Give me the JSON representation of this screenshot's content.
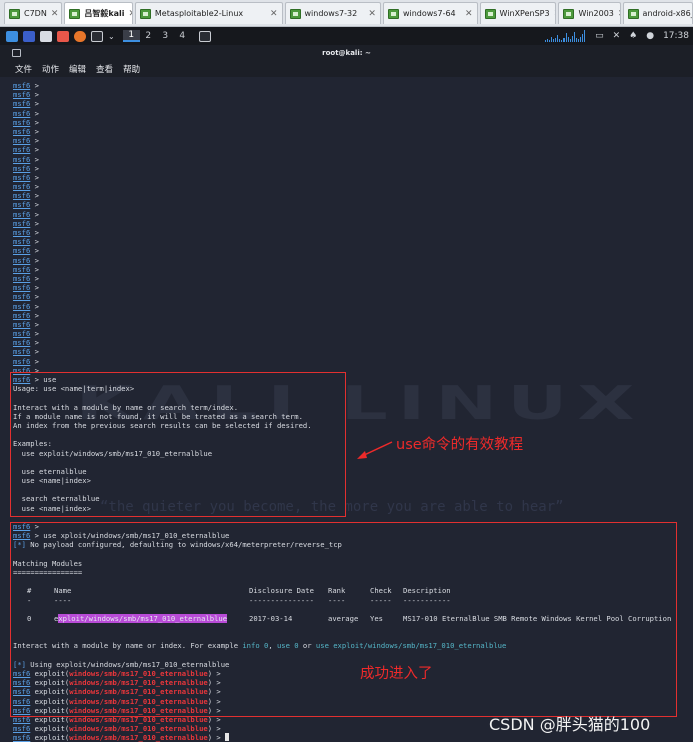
{
  "vm_tabs": [
    {
      "label": "C7DN",
      "active": false
    },
    {
      "label": "吕智毅kali",
      "active": true
    },
    {
      "label": "Metasploitable2-Linux",
      "active": false
    },
    {
      "label": "windows7-32",
      "active": false
    },
    {
      "label": "windows7-64",
      "active": false
    },
    {
      "label": "WinXPenSP3",
      "active": false
    },
    {
      "label": "Win2003",
      "active": false
    },
    {
      "label": "android-x86_64-7...",
      "active": false
    }
  ],
  "panel": {
    "workspaces": [
      "1",
      "2",
      "3",
      "4"
    ],
    "clock": "17:38"
  },
  "window_title": "root@kali: ~",
  "menu": [
    "文件",
    "动作",
    "编辑",
    "查看",
    "帮助"
  ],
  "prompt": "msf6",
  "empty_prompt_count": 32,
  "use_help": [
    "Usage: use <name|term|index>",
    "",
    "Interact with a module by name or search term/index.",
    "If a module name is not found, it will be treated as a search term.",
    "An index from the previous search results can be selected if desired.",
    "",
    "Examples:",
    "  use exploit/windows/smb/ms17_010_eternalblue",
    "",
    "  use eternalblue",
    "  use <name|index>",
    "",
    "  search eternalblue",
    "  use <name|index>"
  ],
  "cmd_use": " > use",
  "cmd_use_exploit": " > use xploit/windows/smb/ms17_010_eternalblue",
  "payload_tag": "[*]",
  "payload_msg": " No payload configured, defaulting to windows/x64/meterpreter/reverse_tcp",
  "matching_title": "Matching Modules",
  "matching_underline": "================",
  "table": {
    "headers": [
      "#",
      "Name",
      "Disclosure Date",
      "Rank",
      "Check",
      "Description"
    ],
    "underlines": [
      "-",
      "----",
      "---------------",
      "----",
      "-----",
      "-----------"
    ],
    "row": {
      "index": "0",
      "name_first": "e",
      "name_rest": "xploit/windows/smb/ms17_010_eternalblue",
      "date": "2017-03-14",
      "rank": "average",
      "check": "Yes",
      "description": "MS17-010 EternalBlue SMB Remote Windows Kernel Pool Corruption"
    }
  },
  "interact": {
    "text1": "Interact with a module by name or index. For example ",
    "info": "info 0",
    "sep": ", ",
    "use0": "use 0",
    "or": " or ",
    "use_full": "use exploit/windows/smb/ms17_010_eternalblue"
  },
  "using_tag": "[*]",
  "using_msg": " Using exploit/windows/smb/ms17_010_eternalblue",
  "exploit_prompt": {
    "prefix": " exploit(",
    "module": "windows/smb/ms17_010_eternalblue",
    "suffix": ") > "
  },
  "exploit_prompt_count": 8,
  "watermark": {
    "title": "KALI LINUX",
    "quote": "“the quieter you become, the more you are able to hear”"
  },
  "annotations": {
    "use_tutorial": "use命令的有效教程",
    "entered": "成功进入了"
  },
  "csdn_watermark": "CSDN @胖头猫的100",
  "colors": {
    "prompt_blue": "#5aa0e6",
    "module_red": "#e8363b",
    "highlight_purple": "#b84bd7",
    "annotation_red": "#ee2a2a",
    "terminal_bg": "#212532"
  }
}
